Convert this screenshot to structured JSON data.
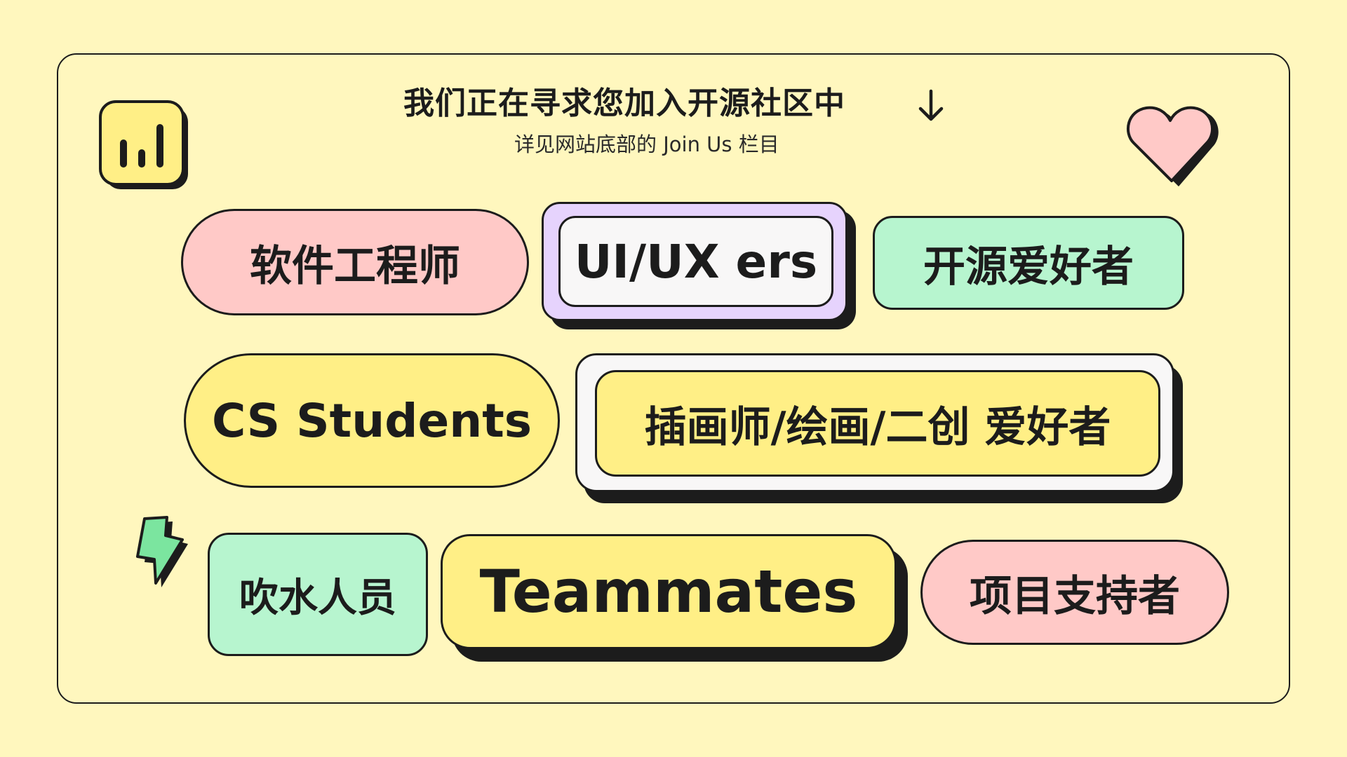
{
  "header": {
    "title": "我们正在寻求您加入开源社区中",
    "subtitle": "详见网站底部的 Join Us 栏目"
  },
  "roles": {
    "software_engineer": "软件工程师",
    "uiux": "UI/UX ers",
    "oss_fan": "开源爱好者",
    "cs_students": "CS Students",
    "illustrator": "插画师/绘画/二创 爱好者",
    "chatter": "吹水人员",
    "teammates": "Teammates",
    "supporter": "项目支持者"
  },
  "icons": {
    "top_left": "chart-icon",
    "top_right": "heart-icon",
    "bottom_left": "lightning-icon",
    "header": "arrow-down-icon"
  },
  "colors": {
    "background": "#FFF7BE",
    "ink": "#1C1C1C",
    "pink": "#FFC9C7",
    "mint": "#B7F5CF",
    "yellow": "#FFEF86",
    "lilac": "#E6D3FD",
    "white": "#F8F7F7"
  }
}
